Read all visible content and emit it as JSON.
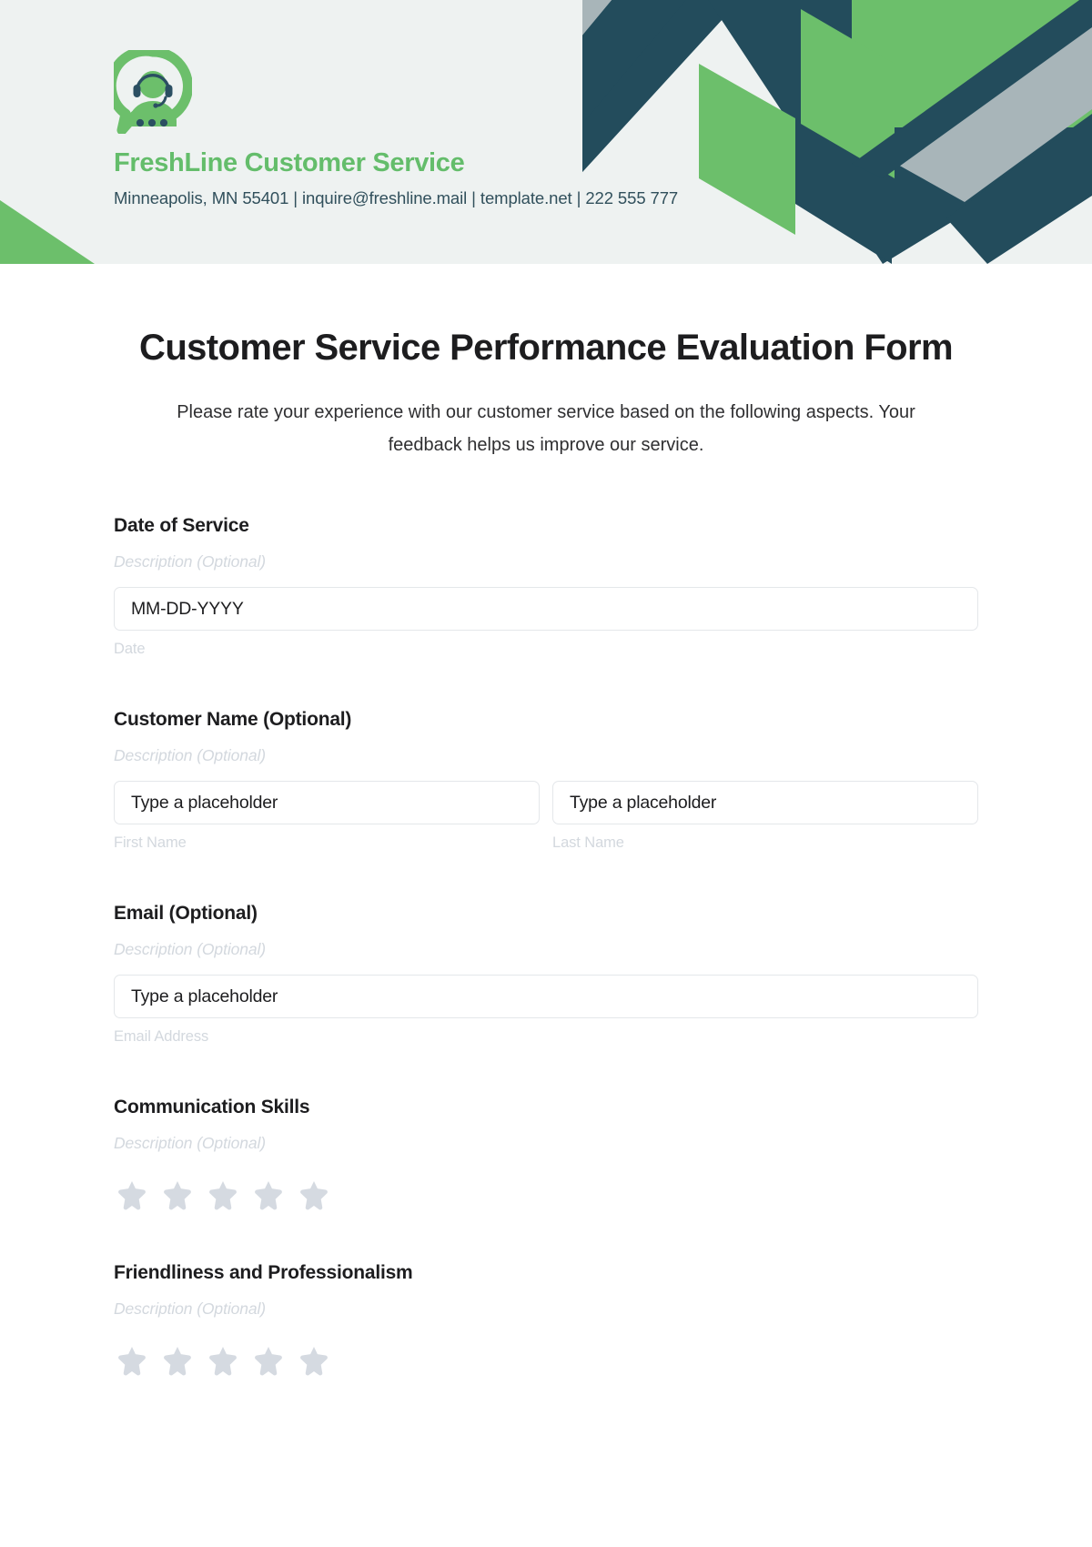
{
  "brand": {
    "name": "FreshLine Customer Service",
    "contact": "Minneapolis, MN 55401 | inquire@freshline.mail | template.net | 222 555 777",
    "logo_icon": "customer-support-headset-speech-bubble-icon",
    "green": "#6cbf6b",
    "dark": "#234c5c",
    "header_bg": "#eef2f1"
  },
  "form": {
    "title": "Customer Service Performance Evaluation Form",
    "subtitle": "Please rate your experience with our customer service based on the following aspects. Your feedback helps us improve our service.",
    "description_placeholder": "Description (Optional)",
    "fields": [
      {
        "label": "Date of Service",
        "description": "Description (Optional)",
        "type": "text",
        "inputs": [
          {
            "value": "MM-DD-YYYY",
            "placeholder": "MM-DD-YYYY",
            "sub_label": "Date",
            "name": "date-of-service-input"
          }
        ]
      },
      {
        "label": "Customer Name (Optional)",
        "description": "Description (Optional)",
        "type": "text",
        "inputs": [
          {
            "value": "Type a placeholder",
            "placeholder": "Type a placeholder",
            "sub_label": "First Name",
            "name": "first-name-input"
          },
          {
            "value": "Type a placeholder",
            "placeholder": "Type a placeholder",
            "sub_label": "Last Name",
            "name": "last-name-input"
          }
        ]
      },
      {
        "label": "Email (Optional)",
        "description": "Description (Optional)",
        "type": "text",
        "inputs": [
          {
            "value": "Type a placeholder",
            "placeholder": "Type a placeholder",
            "sub_label": "Email Address",
            "name": "email-address-input"
          }
        ]
      },
      {
        "label": "Communication Skills",
        "description": "Description (Optional)",
        "type": "rating",
        "star_count": 5,
        "rating_value": 0,
        "star_color": "#d5dae1",
        "name": "communication-skills-rating"
      },
      {
        "label": "Friendliness and Professionalism",
        "description": "Description (Optional)",
        "type": "rating",
        "star_count": 5,
        "rating_value": 0,
        "star_color": "#d5dae1",
        "name": "friendliness-and-professionalism-rating"
      }
    ]
  }
}
